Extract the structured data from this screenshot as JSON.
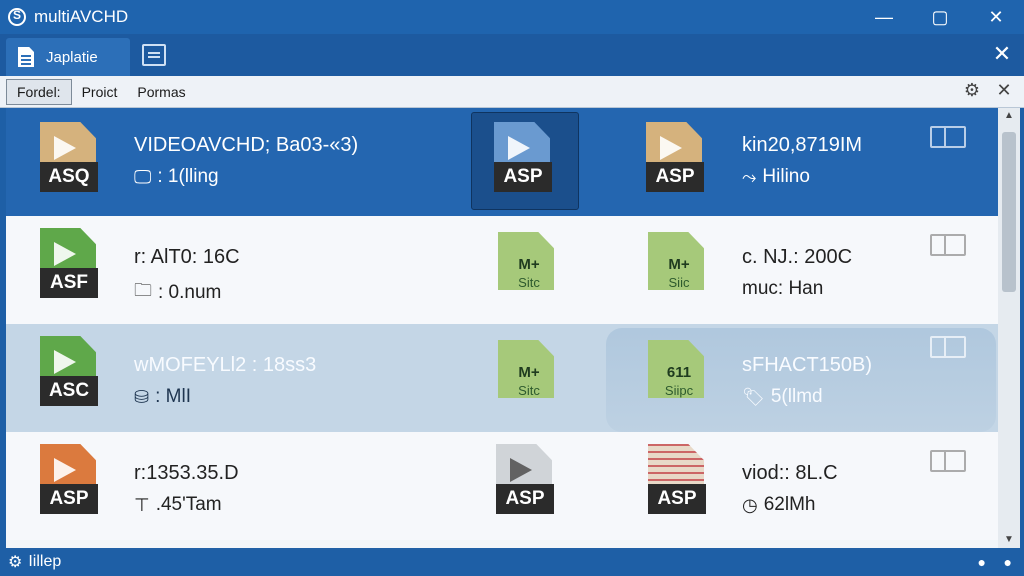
{
  "window": {
    "title": "multiAVCHD",
    "minimize_icon": "minimize-icon",
    "maximize_icon": "maximize-icon",
    "close_icon": "close-icon"
  },
  "tabs": {
    "active_label": "Japlatie",
    "close_symbol": "✕"
  },
  "toolbar": {
    "items": [
      "Fordel:",
      "Proict",
      "Pormas"
    ],
    "settings_symbol": "⚙",
    "close_symbol": "✕"
  },
  "rows": [
    {
      "left_icon": "ASQ",
      "title": "VIDEOAVCHD; Ba03-«3)",
      "subtitle": ": 1(lling",
      "middle_icon": "ASP",
      "right_icon": "ASP",
      "right_title": "kin20,8719IM",
      "right_subtitle": "Hilino"
    },
    {
      "left_icon": "ASF",
      "title": "r: AlT0: 16C",
      "subtitle": ": 0.num",
      "middle_icon_line1": "M+",
      "middle_icon_line2": "Sitc",
      "right_icon_line1": "M+",
      "right_icon_line2": "Siic",
      "right_title": "c. NJ.: 200C",
      "right_subtitle": "muc: Han"
    },
    {
      "left_icon": "ASC",
      "title": "wMOFEYLl2 : 18ss3",
      "subtitle": ": MlI",
      "middle_icon_line1": "M+",
      "middle_icon_line2": "Sitc",
      "right_icon_line1": "611",
      "right_icon_line2": "Siipc",
      "right_title": "sFHACT150B)",
      "right_subtitle": "5(llmd"
    },
    {
      "left_icon": "ASP",
      "title": "r:1353.35.D",
      "subtitle": ".45'Tam",
      "middle_icon": "ASP",
      "right_icon": "ASP",
      "right_title": "viod:: 8L.C",
      "right_subtitle": "62lMh"
    }
  ],
  "status": {
    "label": "Iillep"
  }
}
